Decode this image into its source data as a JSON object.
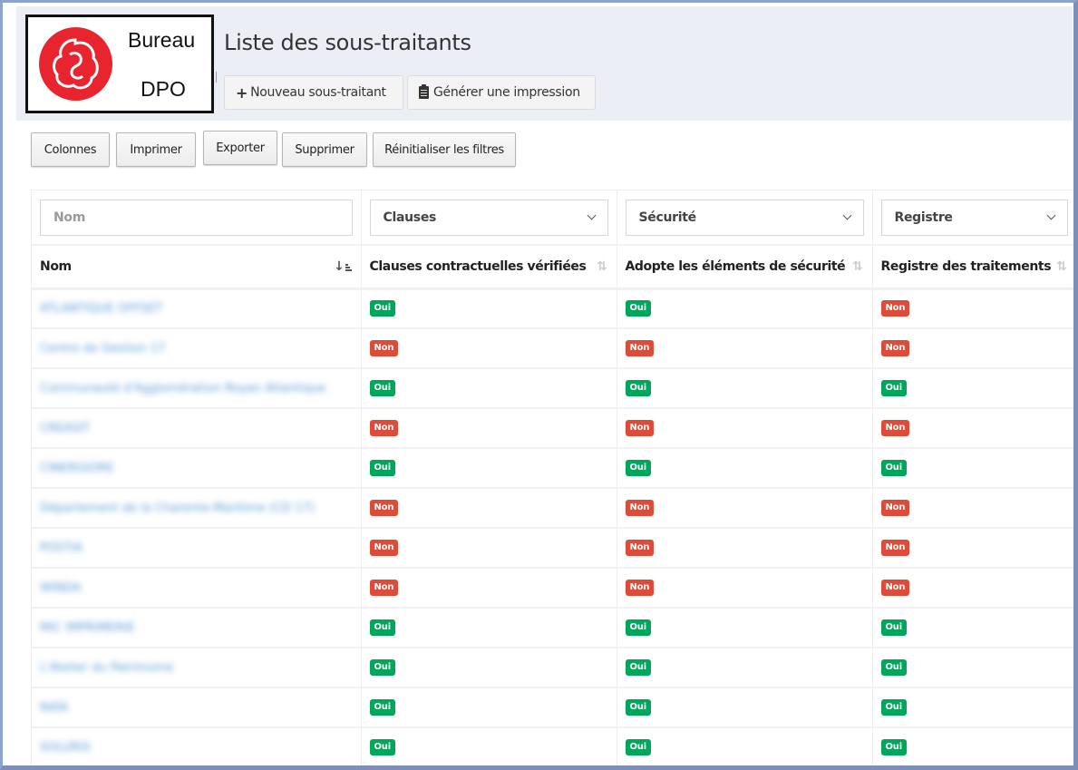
{
  "logo": {
    "line1": "Bureau",
    "line2": "DPO",
    "color": "#e8252f"
  },
  "page": {
    "title": "Liste des sous-traitants"
  },
  "top_actions": {
    "new_label": "Nouveau sous-traitant",
    "new_icon": "plus-icon",
    "print_label": "Générer une impression",
    "print_icon": "clipboard-icon"
  },
  "toolbar": {
    "columns": "Colonnes",
    "print": "Imprimer",
    "export": "Exporter",
    "delete": "Supprimer",
    "reset_filters": "Réinitialiser les filtres"
  },
  "filters": {
    "name_placeholder": "Nom",
    "clauses": "Clauses",
    "security": "Sécurité",
    "registry": "Registre"
  },
  "columns": [
    {
      "label": "Nom",
      "sort": "ascending"
    },
    {
      "label": "Clauses contractuelles vérifiées",
      "sort": "none"
    },
    {
      "label": "Adopte les éléments de sécurité",
      "sort": "none"
    },
    {
      "label": "Registre des traitements",
      "sort": "none"
    }
  ],
  "badge_colors": {
    "Oui": "#00a65a",
    "Non": "#dd4b39"
  },
  "rows": [
    {
      "name": "ATLANTIQUE OFFSET",
      "clauses": "Oui",
      "security": "Oui",
      "registry": "Non"
    },
    {
      "name": "Centre de Gestion 17",
      "clauses": "Non",
      "security": "Non",
      "registry": "Non"
    },
    {
      "name": "Communauté d'Agglomération Royan Atlantique",
      "clauses": "Oui",
      "security": "Oui",
      "registry": "Oui"
    },
    {
      "name": "CREASIT",
      "clauses": "Non",
      "security": "Non",
      "registry": "Non"
    },
    {
      "name": "CINERGIORE",
      "clauses": "Oui",
      "security": "Oui",
      "registry": "Oui"
    },
    {
      "name": "Département de la Charente-Maritime (CD 17)",
      "clauses": "Non",
      "security": "Non",
      "registry": "Non"
    },
    {
      "name": "POSTIA",
      "clauses": "Non",
      "security": "Non",
      "registry": "Non"
    },
    {
      "name": "WINDA",
      "clauses": "Non",
      "security": "Non",
      "registry": "Non"
    },
    {
      "name": "MIC IMPRIMERIE",
      "clauses": "Oui",
      "security": "Oui",
      "registry": "Oui"
    },
    {
      "name": "L'Atelier du Patrimoine",
      "clauses": "Oui",
      "security": "Oui",
      "registry": "Oui"
    },
    {
      "name": "NAÏA",
      "clauses": "Oui",
      "security": "Oui",
      "registry": "Oui"
    },
    {
      "name": "SOLURIS",
      "clauses": "Oui",
      "security": "Oui",
      "registry": "Oui"
    }
  ]
}
